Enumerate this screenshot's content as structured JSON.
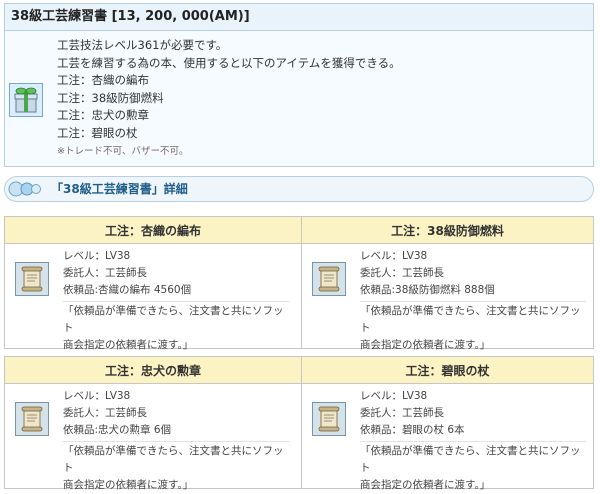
{
  "item": {
    "title": "38級工芸練習書 [13, 200, 000(AM)]",
    "icon": "gift-box-icon",
    "lines": [
      "工芸技法レベル361が必要です。",
      "工芸を練習する為の本、使用すると以下のアイテムを獲得できる。",
      "工注：杏織の編布",
      "工注：38級防御燃料",
      "工注：忠犬の勲章",
      "工注：碧眼の杖"
    ],
    "note": "※トレード不可、バザー不可。"
  },
  "section": {
    "title": "「38級工芸練習書」詳細",
    "icon": "chat-bubbles-icon"
  },
  "orders": [
    {
      "header": "工注：杏織の編布",
      "icon": "scroll-icon",
      "level": "レベル：LV38",
      "client": "委託人：工芸師長",
      "request": "依頼品:杏織の編布 4560個",
      "quote1": "「依頼品が準備できたら、注文書と共にソフット",
      "quote2": "商会指定の依頼者に渡す。」"
    },
    {
      "header": "工注：38級防御燃料",
      "icon": "scroll-icon",
      "level": "レベル：LV38",
      "client": "委託人：工芸師長",
      "request": "依頼品:38級防御燃料 888個",
      "quote1": "「依頼品が準備できたら、注文書と共にソフット",
      "quote2": "商会指定の依頼者に渡す。」"
    },
    {
      "header": "工注：忠犬の勲章",
      "icon": "scroll-icon",
      "level": "レベル：LV38",
      "client": "委託人：工芸師長",
      "request": "依頼品:忠犬の勲章 6個",
      "quote1": "「依頼品が準備できたら、注文書と共にソフット",
      "quote2": "商会指定の依頼者に渡す。」"
    },
    {
      "header": "工注：碧眼の杖",
      "icon": "scroll-icon",
      "level": "レベル：LV38",
      "client": "委託人：工芸師長",
      "request": "依頼品：碧眼の杖 6本",
      "quote1": "「依頼品が準備できたら、注文書と共にソフット",
      "quote2": "商会指定の依頼者に渡す。」"
    }
  ]
}
